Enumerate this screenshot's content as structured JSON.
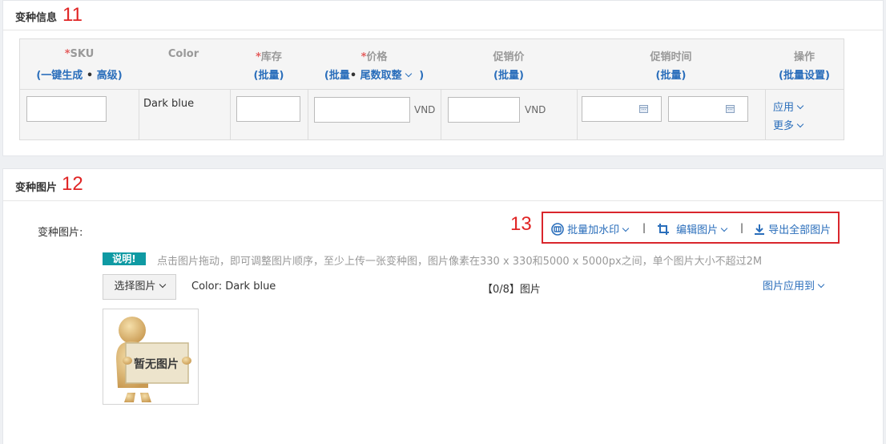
{
  "variant_info": {
    "title": "变种信息",
    "annotation": "11",
    "columns": {
      "sku": {
        "required_mark": "*",
        "label": "SKU",
        "sub_open": "(",
        "sub_link1": "一键生成",
        "sub_dot": "•",
        "sub_link2": "高级",
        "sub_close": ")"
      },
      "color": {
        "label": "Color"
      },
      "stock": {
        "required_mark": "*",
        "label": "库存",
        "sub_open": "(",
        "sub_link": "批量",
        "sub_close": ")"
      },
      "price": {
        "required_mark": "*",
        "label": "价格",
        "sub_open": "(",
        "sub_link1": "批量",
        "sub_dot": "•",
        "sub_link2": "尾数取整",
        "sub_close": ")"
      },
      "promo_price": {
        "label": "促销价",
        "sub_open": "(",
        "sub_link": "批量",
        "sub_close": ")"
      },
      "promo_time": {
        "label": "促销时间",
        "sub_open": "(",
        "sub_link": "批量",
        "sub_close": ")"
      },
      "actions": {
        "label": "操作",
        "sub_open": "(",
        "sub_link": "批量设置",
        "sub_close": ")"
      }
    },
    "row": {
      "sku_value": "",
      "color_value": "Dark blue",
      "stock_value": "",
      "price_value": "",
      "price_unit": "VND",
      "promo_price_value": "",
      "promo_price_unit": "VND",
      "promo_start": "",
      "promo_end": "",
      "apply_label": "应用",
      "more_label": "更多"
    }
  },
  "variant_images": {
    "title": "变种图片",
    "annotation": "12",
    "field_label": "变种图片:",
    "toolbar_annotation": "13",
    "toolbar": {
      "watermark_label": "批量加水印",
      "edit_label": "编辑图片",
      "export_label": "导出全部图片",
      "separator": "|"
    },
    "tag_label": "说明!",
    "note": "点击图片拖动，即可调整图片顺序，至少上传一张变种图，图片像素在330 x 330和5000 x 5000px之间，单个图片大小不超过2M",
    "select_button": "选择图片",
    "color_label": "Color: Dark blue",
    "count_label": "【0/8】图片",
    "apply_to_label": "图片应用到",
    "placeholder_text": "暂无图片"
  }
}
